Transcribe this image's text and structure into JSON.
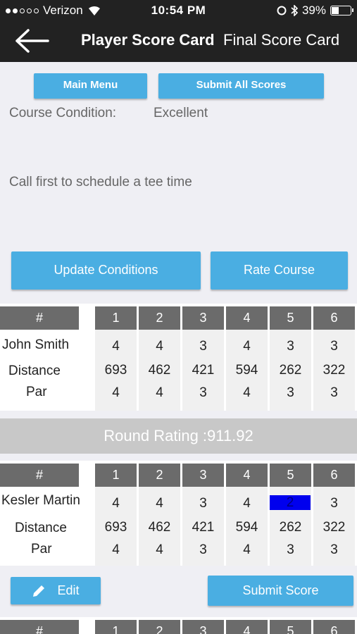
{
  "status": {
    "carrier": "Verizon",
    "time": "10:54 PM",
    "battery": "39%"
  },
  "nav": {
    "title": "Player Score Card",
    "subtitle": "Final Score Card"
  },
  "top": {
    "main_menu": "Main Menu",
    "submit_all": "Submit All Scores",
    "condition_label": "Course Condition:",
    "condition_value": "Excellent",
    "note": "Call first to schedule a tee time",
    "update_conditions": "Update Conditions",
    "rate_course": "Rate Course"
  },
  "cards": [
    {
      "hash": "#",
      "holes": [
        "1",
        "2",
        "3",
        "4",
        "5",
        "6"
      ],
      "player": "John Smith",
      "scores": [
        "4",
        "4",
        "3",
        "4",
        "3",
        "3"
      ],
      "distance_label": "Distance",
      "distances": [
        "693",
        "462",
        "421",
        "594",
        "262",
        "322"
      ],
      "par_label": "Par",
      "pars": [
        "4",
        "4",
        "3",
        "4",
        "3",
        "3"
      ]
    },
    {
      "hash": "#",
      "holes": [
        "1",
        "2",
        "3",
        "4",
        "5",
        "6"
      ],
      "player": "Kesler Martin",
      "scores": [
        "4",
        "4",
        "3",
        "4",
        "2",
        "3"
      ],
      "distance_label": "Distance",
      "distances": [
        "693",
        "462",
        "421",
        "594",
        "262",
        "322"
      ],
      "par_label": "Par",
      "pars": [
        "4",
        "4",
        "3",
        "4",
        "3",
        "3"
      ]
    },
    {
      "hash": "#",
      "holes": [
        "1",
        "2",
        "3",
        "4",
        "5",
        "6"
      ]
    }
  ],
  "round_rating": "Round Rating :911.92",
  "actions": {
    "edit": "Edit",
    "submit_score": "Submit Score"
  },
  "colors": {
    "accent": "#4aaee2",
    "header": "#6b6b6b",
    "highlight": "#0000ee",
    "dark_bar": "#222222"
  }
}
